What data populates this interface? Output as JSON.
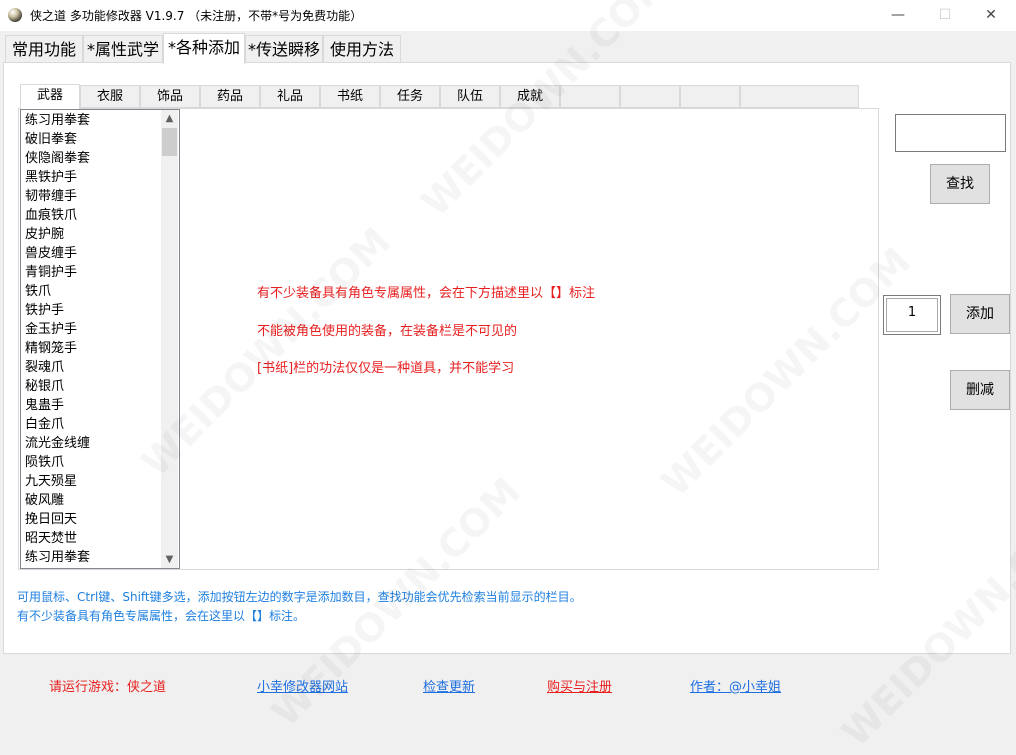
{
  "window": {
    "title": "侠之道 多功能修改器  V1.9.7  （未注册，不带*号为免费功能）",
    "min": "—",
    "max": "☐",
    "close": "✕"
  },
  "main_tabs": [
    "常用功能",
    "*属性武学",
    "*各种添加",
    "*传送瞬移",
    "使用方法"
  ],
  "active_main_tab": "*各种添加",
  "sub_tabs": [
    "武器",
    "衣服",
    "饰品",
    "药品",
    "礼品",
    "书纸",
    "任务",
    "队伍",
    "成就",
    "",
    "",
    "",
    ""
  ],
  "active_sub_tab": "武器",
  "items": [
    "练习用拳套",
    "破旧拳套",
    "侠隐阁拳套",
    "黑铁护手",
    "韧带缠手",
    "血痕铁爪",
    "皮护腕",
    "兽皮缠手",
    "青铜护手",
    "铁爪",
    "铁护手",
    "金玉护手",
    "精钢笼手",
    "裂魂爪",
    "秘银爪",
    "鬼蛊手",
    "白金爪",
    "流光金线缠",
    "陨铁爪",
    "九天殒星",
    "破风雕",
    "挽日回天",
    "昭天焚世",
    "练习用拳套"
  ],
  "hints": [
    "有不少装备具有角色专属属性，会在下方描述里以【】标注",
    "不能被角色使用的装备，在装备栏是不可见的",
    "[书纸]栏的功法仅仅是一种道具，并不能学习"
  ],
  "controls": {
    "search_value": "",
    "find_label": "查找",
    "quantity": "1",
    "add_label": "添加",
    "delete_label": "删减"
  },
  "info_lines": [
    "可用鼠标、Ctrl键、Shift键多选，添加按钮左边的数字是添加数目，查找功能会优先检索当前显示的栏目。",
    "有不少装备具有角色专属属性，会在这里以【】标注。"
  ],
  "footer": {
    "status": "请运行游戏：侠之道",
    "site_link": "小幸修改器网站",
    "update_link": "检查更新",
    "buy_link": "购买与注册",
    "author_link": "作者：@小幸姐"
  },
  "watermark_text": "WEIDOWN.COM"
}
